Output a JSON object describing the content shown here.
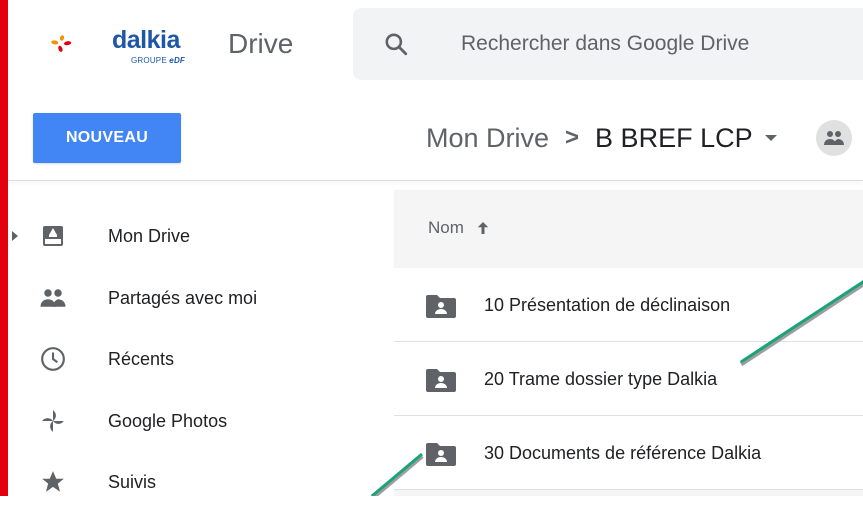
{
  "brand": {
    "name": "dalkia",
    "sub_prefix": "GROUPE ",
    "sub_bold": "eDF"
  },
  "app": {
    "name": "Drive"
  },
  "search": {
    "placeholder": "Rechercher dans Google Drive",
    "value": ""
  },
  "toolbar": {
    "new_label": "NOUVEAU"
  },
  "breadcrumb": {
    "root": "Mon Drive",
    "separator": ">",
    "current": "B BREF LCP"
  },
  "sidebar": {
    "items": [
      {
        "label": "Mon Drive",
        "icon": "drive-icon"
      },
      {
        "label": "Partagés avec moi",
        "icon": "people-icon"
      },
      {
        "label": "Récents",
        "icon": "clock-icon"
      },
      {
        "label": "Google Photos",
        "icon": "pinwheel-icon"
      },
      {
        "label": "Suivis",
        "icon": "star-icon"
      }
    ]
  },
  "files": {
    "column_name": "Nom",
    "rows": [
      {
        "name": "10 Présentation de déclinaison",
        "icon": "shared-folder-icon"
      },
      {
        "name": "20 Trame dossier type Dalkia",
        "icon": "shared-folder-icon"
      },
      {
        "name": "30 Documents de référence Dalkia",
        "icon": "shared-folder-icon"
      }
    ]
  },
  "colors": {
    "accent_red": "#e3000f",
    "button_blue": "#4285f4",
    "brand_blue": "#1e57a8",
    "brand_orange": "#f39200",
    "annotation_green": "#1aa37a"
  }
}
